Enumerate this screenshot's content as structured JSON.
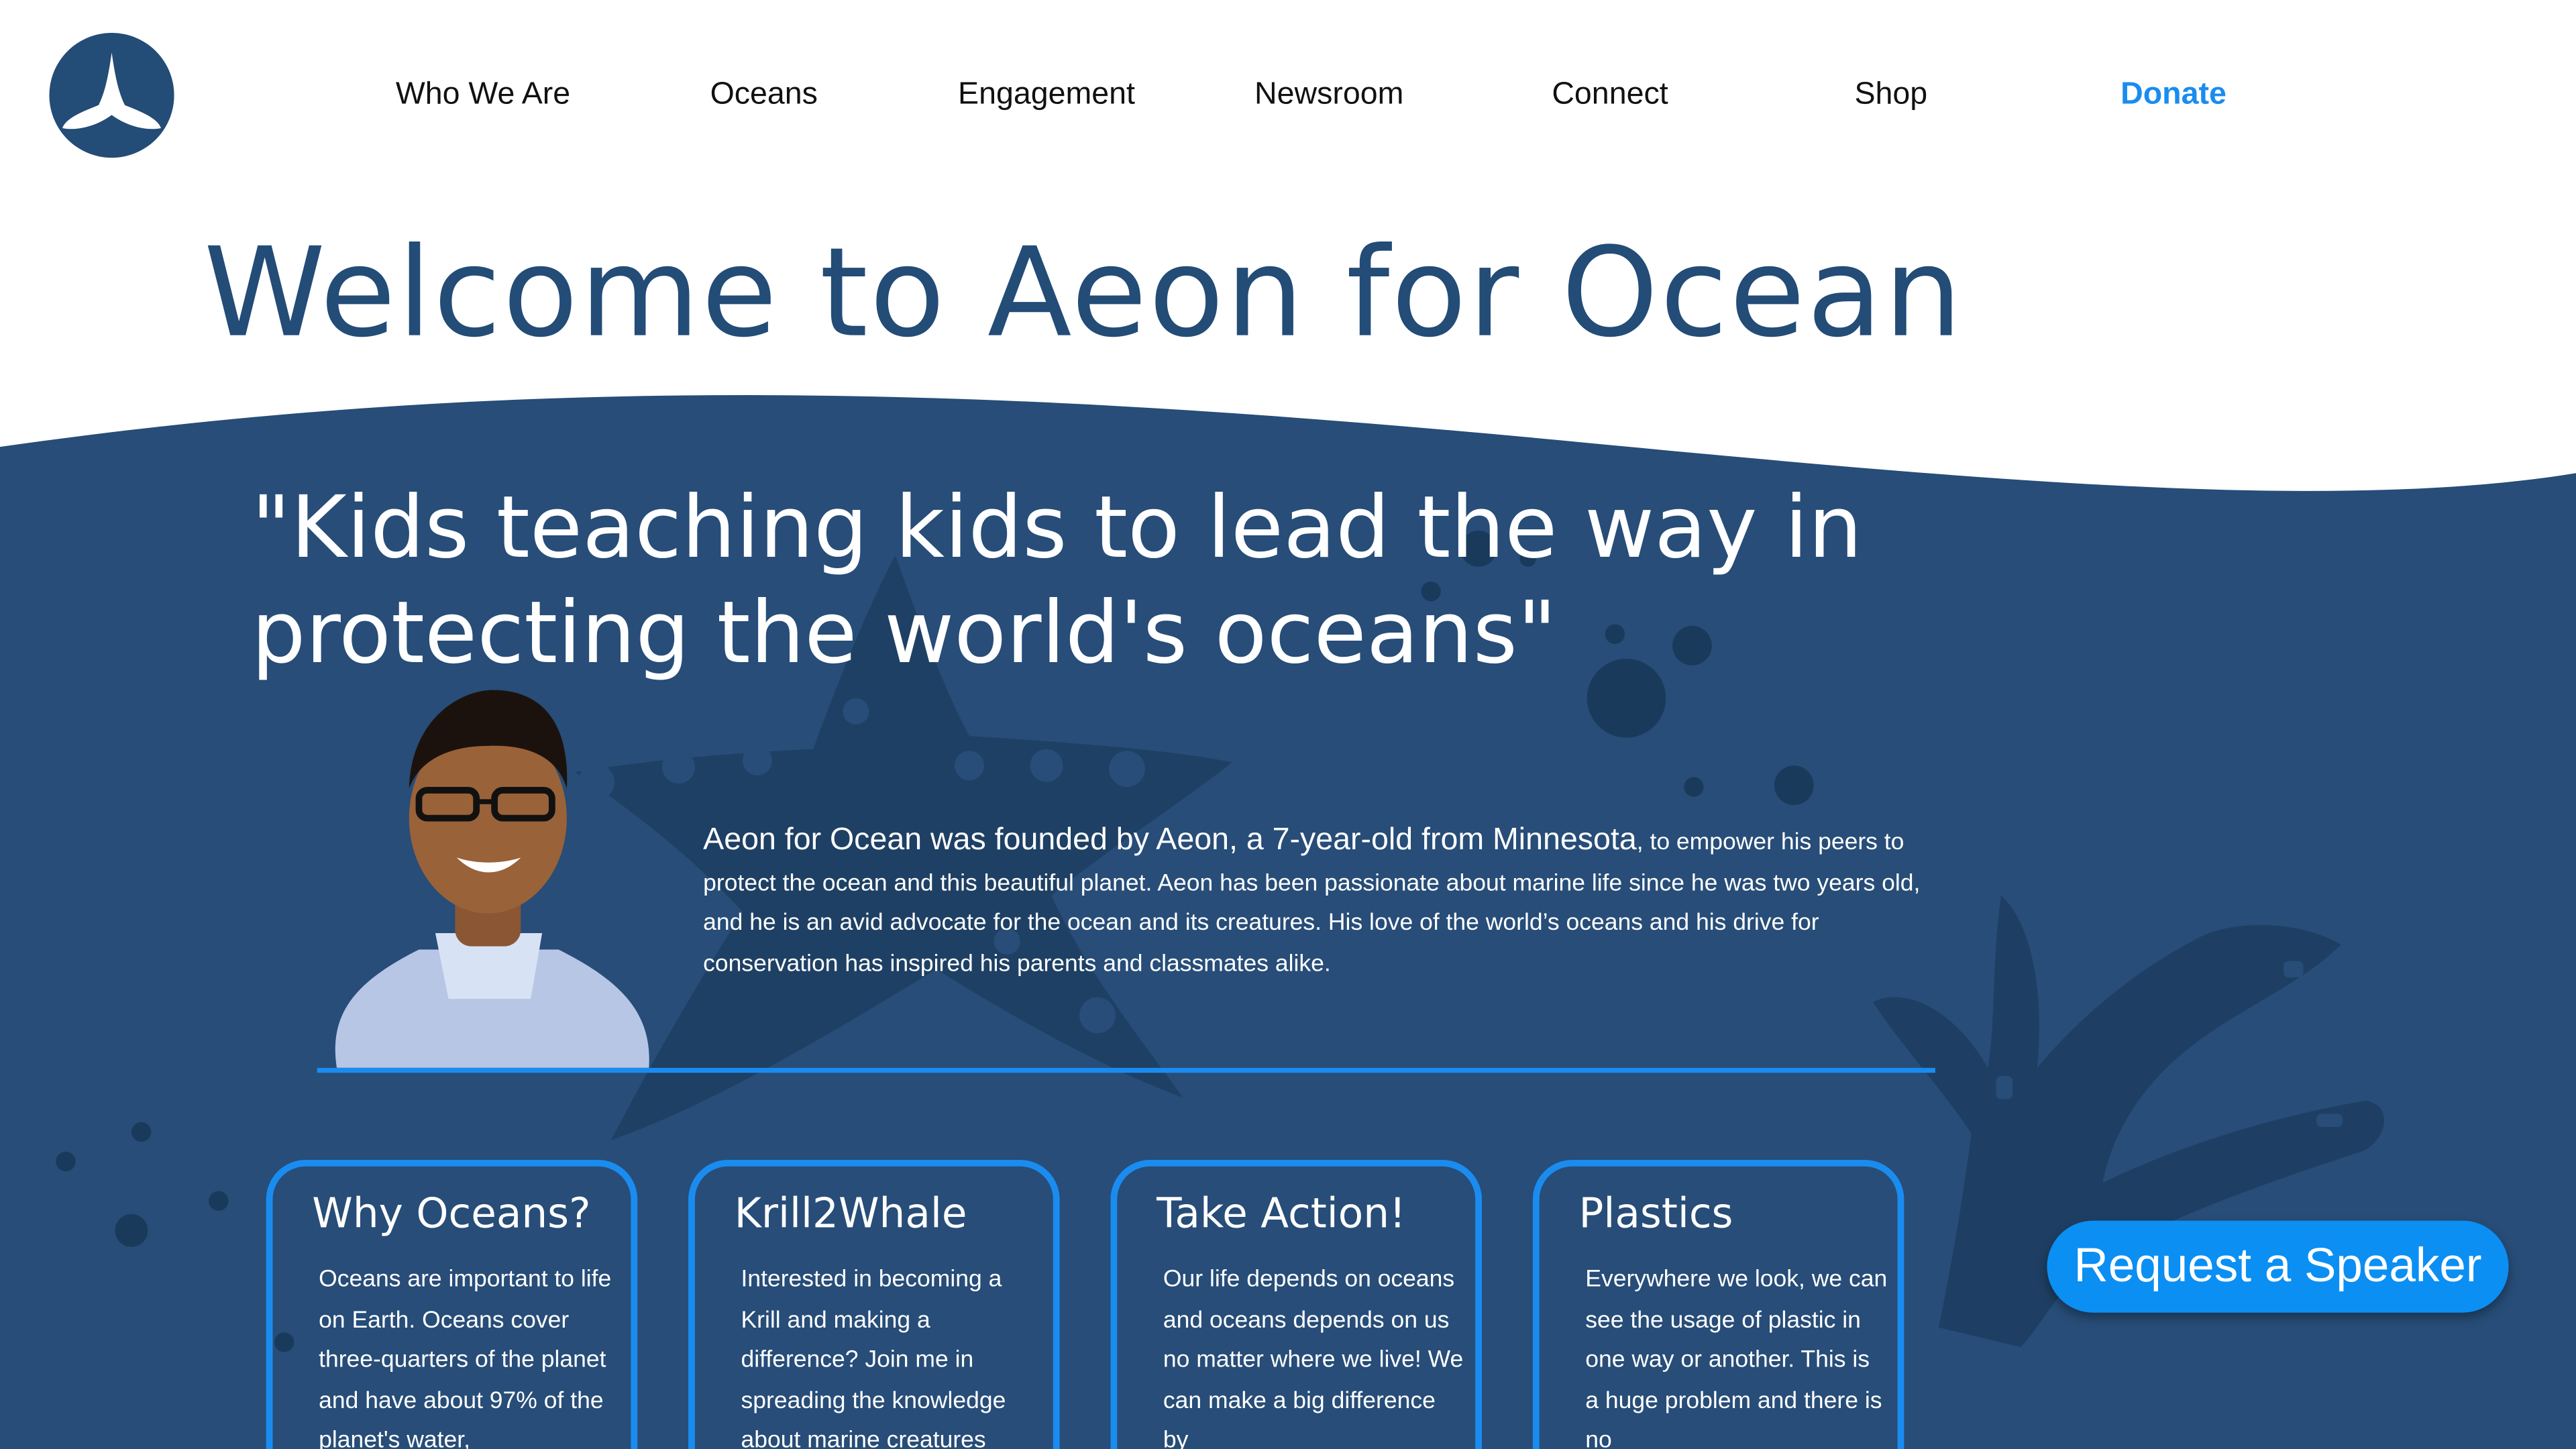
{
  "header": {
    "logo_icon": "whale-tail-logo-icon",
    "nav": [
      {
        "label": "Who We Are"
      },
      {
        "label": "Oceans"
      },
      {
        "label": "Engagement"
      },
      {
        "label": "Newsroom"
      },
      {
        "label": "Connect"
      },
      {
        "label": "Shop"
      },
      {
        "label": "Donate"
      }
    ]
  },
  "hero": {
    "title": "Welcome to Aeon for Ocean"
  },
  "intro": {
    "quote_line1": "\"Kids teaching kids to lead the way in",
    "quote_line2": "protecting the world's oceans\"",
    "about_lead": "Aeon for Ocean was founded by Aeon, a 7-year-old from Minnesota",
    "about_rest": ", to empower his peers to protect the ocean and this beautiful planet. Aeon has been passionate about marine life since he was two years old, and he is an avid advocate for the ocean and its creatures. His love of the world’s oceans and his drive for conservation has inspired his parents and classmates alike."
  },
  "cards": [
    {
      "title": "Why Oceans?",
      "body": "Oceans are important to life on Earth. Oceans cover three-quarters of the planet and have about 97% of the planet's water,"
    },
    {
      "title": "Krill2Whale",
      "body": "Interested in becoming a Krill and making a difference? Join me in spreading the knowledge about marine creatures"
    },
    {
      "title": "Take Action!",
      "body": "Our life depends on oceans and oceans depends on us no matter where we live! We can make a big difference by"
    },
    {
      "title": "Plastics",
      "body": "Everywhere we look, we can see the usage of plastic in one way or another. This is a huge problem and there is no"
    }
  ],
  "cta": {
    "label": "Request a Speaker"
  },
  "colors": {
    "navy": "#234c77",
    "ocean": "#274d78",
    "accent_blue": "#1a8cf0"
  }
}
